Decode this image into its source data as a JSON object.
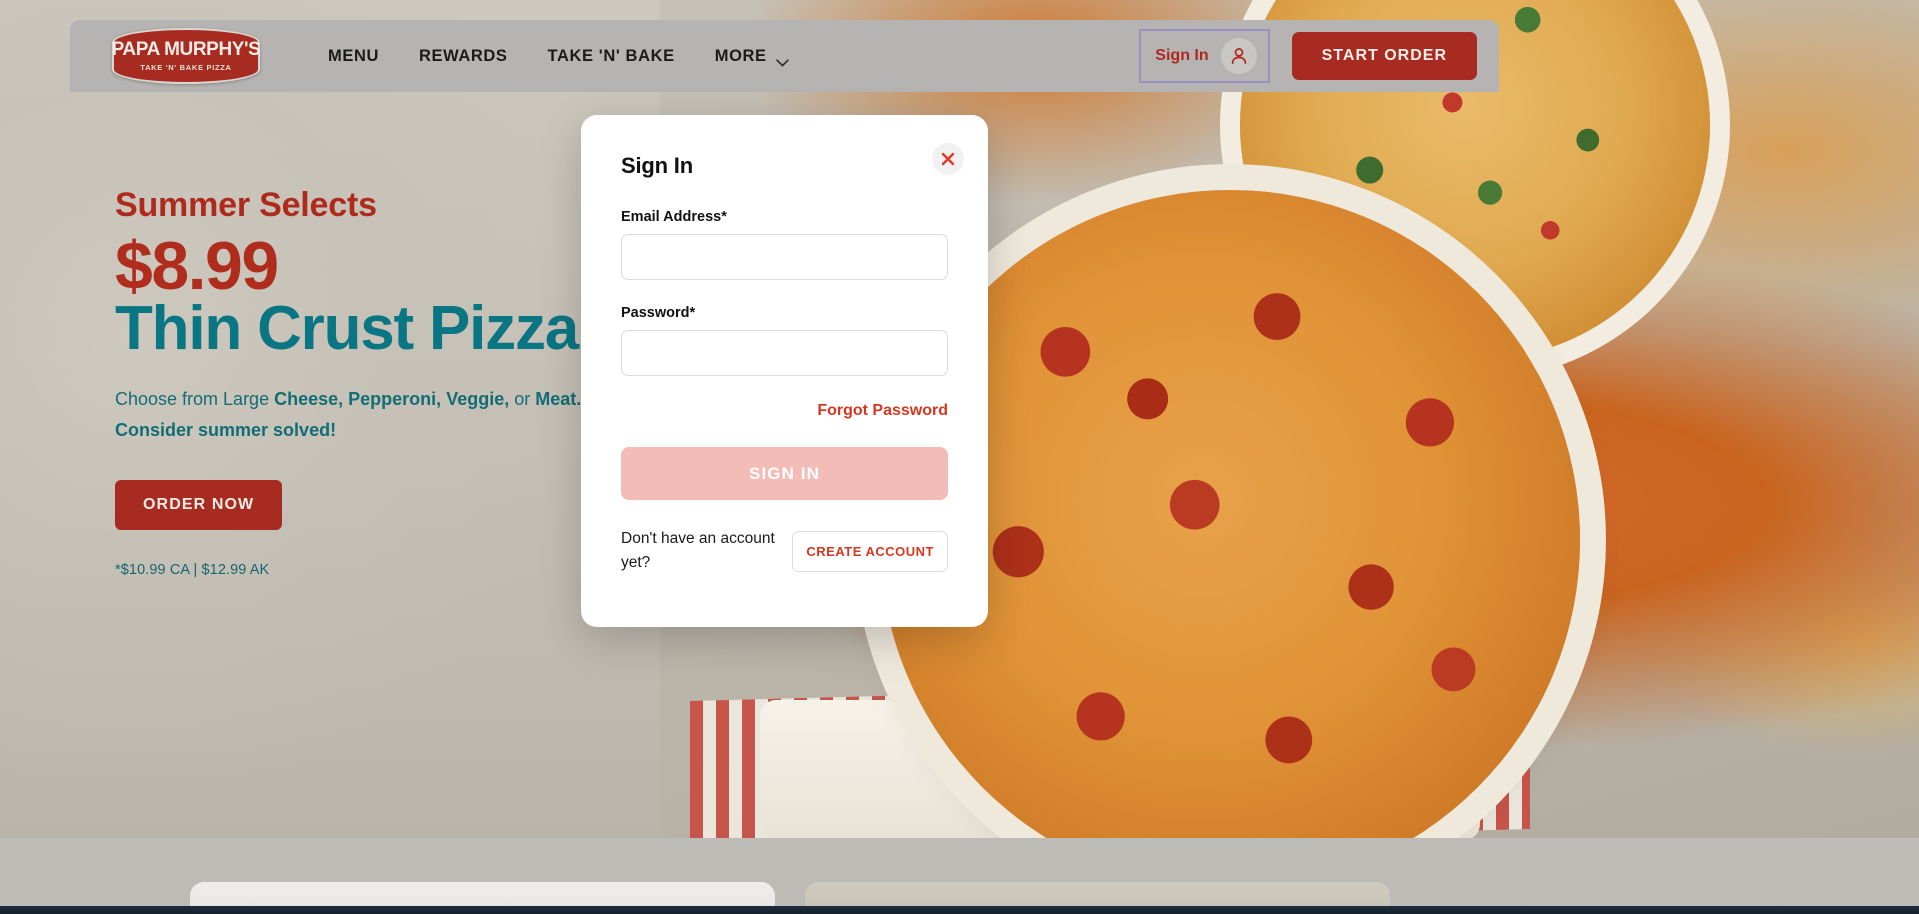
{
  "nav": {
    "logo": {
      "primary": "PAPA MURPHY'S",
      "secondary": "TAKE 'N' BAKE PIZZA"
    },
    "links": [
      {
        "label": "MENU"
      },
      {
        "label": "REWARDS"
      },
      {
        "label": "TAKE 'N' BAKE"
      },
      {
        "label": "MORE"
      }
    ],
    "sign_in_label": "Sign In",
    "start_order_label": "START ORDER"
  },
  "hero": {
    "eyebrow": "Summer Selects",
    "price": "$8.99",
    "headline": "Thin Crust Pizza",
    "desc_prefix": "Choose from Large ",
    "desc_item1": "Cheese,",
    "desc_sep1": " ",
    "desc_item2": "Pepperoni,",
    "desc_sep2": " ",
    "desc_item3": "Veggie,",
    "desc_mid": " or ",
    "desc_item4": "Meat.",
    "desc_line2": "Consider summer solved!",
    "order_now_label": "ORDER NOW",
    "disclaimer": "*$10.99 CA | $12.99 AK"
  },
  "modal": {
    "title": "Sign In",
    "close_label": "×",
    "email": {
      "label": "Email Address*",
      "value": "",
      "placeholder": ""
    },
    "password": {
      "label": "Password*",
      "value": "",
      "placeholder": ""
    },
    "forgot_password_label": "Forgot Password",
    "submit_label": "SIGN IN",
    "no_account_text": "Don't have an account yet?",
    "create_account_label": "CREATE ACCOUNT"
  },
  "colors": {
    "brand_red": "#a82b21",
    "link_red": "#d6381f",
    "teal": "#0a7683",
    "disabled_pink": "#f3bcb6",
    "focus_purple": "#9c8fc4"
  }
}
